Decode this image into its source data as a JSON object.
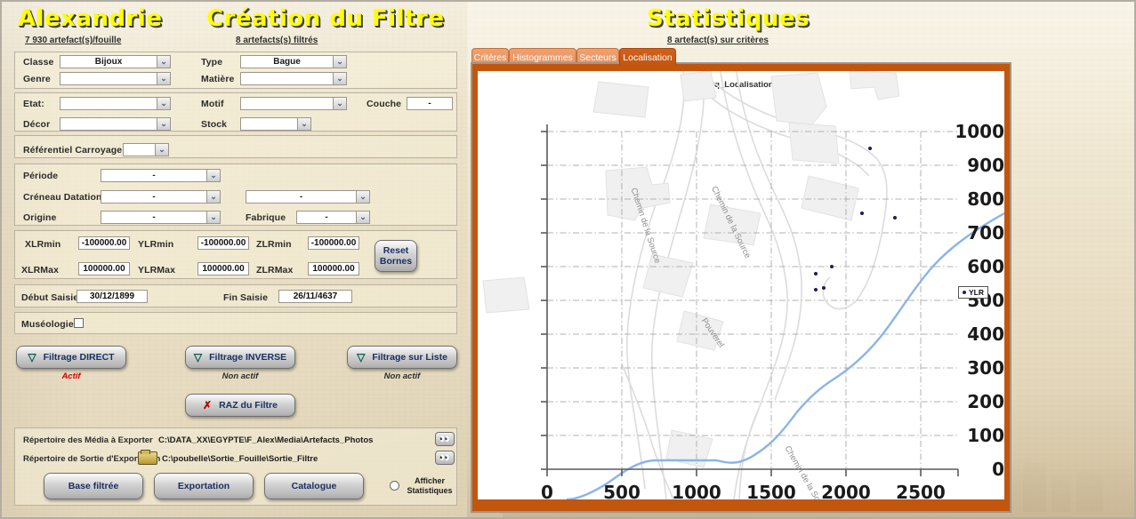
{
  "left_panel": {
    "site_title": "Alexandrie",
    "site_count": "7 930 artefact(s)/fouille",
    "filter_title": "Création du Filtre",
    "filter_count": "8 artefacts(s) filtrés",
    "fields": {
      "classe_label": "Classe",
      "classe_value": "Bijoux",
      "genre_label": "Genre",
      "genre_value": "",
      "type_label": "Type",
      "type_value": "Bague",
      "matiere_label": "Matière",
      "matiere_value": "",
      "etat_label": "Etat:",
      "etat_value": "",
      "decor_label": "Décor",
      "decor_value": "",
      "motif_label": "Motif",
      "motif_value": "",
      "stock_label": "Stock",
      "stock_value": "",
      "couche_label": "Couche",
      "couche_value": "-",
      "referentiel_label": "Référentiel Carroyage",
      "referentiel_value": "",
      "periode_label": "Période",
      "periode_value": "-",
      "creneau_label": "Créneau Datation",
      "creneau_value1": "-",
      "creneau_value2": "-",
      "origine_label": "Origine",
      "origine_value": "-",
      "fabrique_label": "Fabrique",
      "fabrique_value": "-"
    },
    "bornes": {
      "xlrmin_label": "XLRmin",
      "xlrmin_value": "-100000.00",
      "ylrmin_label": "YLRmin",
      "ylrmin_value": "-100000.00",
      "zlrmin_label": "ZLRmin",
      "zlrmin_value": "-100000.00",
      "xlrmax_label": "XLRMax",
      "xlrmax_value": "100000.00",
      "ylrmax_label": "YLRMax",
      "ylrmax_value": "100000.00",
      "zlrmax_label": "ZLRMax",
      "zlrmax_value": "100000.00",
      "reset_line1": "Reset",
      "reset_line2": "Bornes"
    },
    "saisie": {
      "debut_label": "Début Saisie",
      "debut_value": "30/12/1899",
      "fin_label": "Fin Saisie",
      "fin_value": "26/11/4637"
    },
    "museologie_label": "Muséologie",
    "museologie_checked": false,
    "filter_buttons": [
      {
        "label": "Filtrage DIRECT",
        "state": "Actif",
        "state_kind": "actif"
      },
      {
        "label": "Filtrage INVERSE",
        "state": "Non actif",
        "state_kind": "inactif"
      },
      {
        "label": "Filtrage sur Liste",
        "state": "Non actif",
        "state_kind": "inactif"
      }
    ],
    "raz_button": "RAZ du  Filtre",
    "export": {
      "media_label": "Répertoire des Média à Exporter",
      "media_path": "C:\\DATA_XX\\EGYPTE\\F_Alex\\Media\\Artefacts_Photos",
      "sortie_label": "Répertoire de Sortie d'Exportation",
      "sortie_path": "C:\\poubelle\\Sortie_Fouille\\Sortie_Filtre"
    },
    "bottom_buttons": [
      "Base filtrée",
      "Exportation",
      "Catalogue"
    ],
    "afficher_stats_line1": "Afficher",
    "afficher_stats_line2": "Statistiques",
    "afficher_stats_selected": false
  },
  "right_panel": {
    "title": "Statistiques",
    "count": "8 artefact(s) sur critères",
    "tabs": [
      {
        "label": "Critères",
        "active": false
      },
      {
        "label": "Histogrammes",
        "active": false
      },
      {
        "label": "Secteurs",
        "active": false
      },
      {
        "label": "Localisation",
        "active": true
      }
    ]
  },
  "colors": {
    "accent_orange": "#c2560f",
    "tab_inactive": "#e8915c",
    "title_yellow": "#ffff00",
    "point_navy": "#1b1b64",
    "river_blue": "#8ab4e8",
    "active_red": "#d00000"
  },
  "chart_data": {
    "type": "scatter",
    "title": "Rq_Localisation",
    "xlabel": "",
    "ylabel": "",
    "legend": [
      "YLR"
    ],
    "legend_position": "right",
    "grid": true,
    "xlim": [
      0,
      2750
    ],
    "ylim": [
      0,
      1050
    ],
    "xticks": [
      0,
      500,
      1000,
      1500,
      2000,
      2500
    ],
    "yticks": [
      0,
      100,
      200,
      300,
      400,
      500,
      600,
      700,
      800,
      900,
      1000
    ],
    "series": [
      {
        "name": "YLR",
        "points": [
          {
            "x": 2160,
            "y": 950
          },
          {
            "x": 2110,
            "y": 757
          },
          {
            "x": 2325,
            "y": 745
          },
          {
            "x": 1905,
            "y": 600
          },
          {
            "x": 1800,
            "y": 578
          },
          {
            "x": 1795,
            "y": 532
          },
          {
            "x": 1850,
            "y": 537
          }
        ]
      }
    ],
    "basemap_labels": [
      "Chemin de la Source",
      "Chemin de la Source",
      "Pouverel",
      "Chemin de la Source"
    ]
  }
}
